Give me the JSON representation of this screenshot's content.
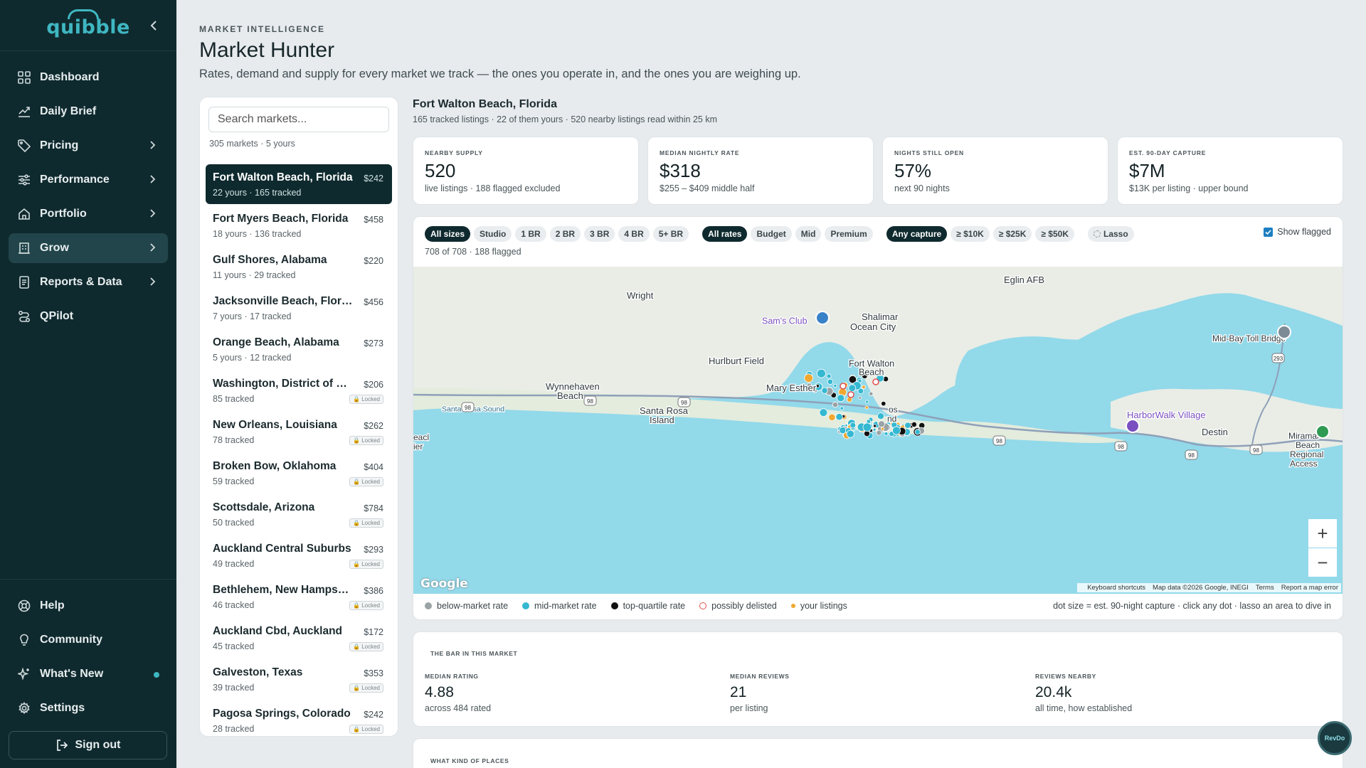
{
  "app": {
    "logo_text": "quibble",
    "brand_color": "#3fb7c2",
    "sidebar_bg": "#0f2a2e"
  },
  "sidebar": {
    "items": [
      {
        "label": "Dashboard",
        "icon": "grid-icon"
      },
      {
        "label": "Daily Brief",
        "icon": "chart-up-icon"
      },
      {
        "label": "Pricing",
        "icon": "tag-icon",
        "has_submenu": true
      },
      {
        "label": "Performance",
        "icon": "sliders-icon",
        "has_submenu": true
      },
      {
        "label": "Portfolio",
        "icon": "home-icon",
        "has_submenu": true
      },
      {
        "label": "Grow",
        "icon": "building-icon",
        "has_submenu": true,
        "active": true
      },
      {
        "label": "Reports & Data",
        "icon": "document-icon",
        "has_submenu": true
      },
      {
        "label": "QPilot",
        "icon": "route-icon"
      }
    ],
    "bottom_items": [
      {
        "label": "Help",
        "icon": "help-icon"
      },
      {
        "label": "Community",
        "icon": "lightbulb-icon"
      },
      {
        "label": "What's New",
        "icon": "sparkle-icon",
        "badge_dot": true
      },
      {
        "label": "Settings",
        "icon": "gear-icon"
      }
    ],
    "sign_out": "Sign out"
  },
  "header": {
    "eyebrow": "MARKET INTELLIGENCE",
    "title": "Market Hunter",
    "subtitle": "Rates, demand and supply for every market we track — the ones you operate in, and the ones you are weighing up."
  },
  "market_list": {
    "search_placeholder": "Search markets...",
    "count": "305 markets · 5 yours",
    "markets": [
      {
        "name": "Fort Walton Beach, Florida",
        "meta": "22 yours · 165 tracked",
        "price": "$242",
        "selected": true,
        "locked": false
      },
      {
        "name": "Fort Myers Beach, Florida",
        "meta": "18 yours · 136 tracked",
        "price": "$458",
        "locked": false
      },
      {
        "name": "Gulf Shores, Alabama",
        "meta": "11 yours · 29 tracked",
        "price": "$220",
        "locked": false
      },
      {
        "name": "Jacksonville Beach, Florida",
        "meta": "7 yours · 17 tracked",
        "price": "$456",
        "locked": false
      },
      {
        "name": "Orange Beach, Alabama",
        "meta": "5 yours · 12 tracked",
        "price": "$273",
        "locked": false
      },
      {
        "name": "Washington, District of Columbia",
        "meta": "85 tracked",
        "price": "$206",
        "locked": true
      },
      {
        "name": "New Orleans, Louisiana",
        "meta": "78 tracked",
        "price": "$262",
        "locked": true
      },
      {
        "name": "Broken Bow, Oklahoma",
        "meta": "59 tracked",
        "price": "$404",
        "locked": true
      },
      {
        "name": "Scottsdale, Arizona",
        "meta": "50 tracked",
        "price": "$784",
        "locked": true
      },
      {
        "name": "Auckland Central Suburbs",
        "meta": "49 tracked",
        "price": "$293",
        "locked": true
      },
      {
        "name": "Bethlehem, New Hampshire",
        "meta": "46 tracked",
        "price": "$386",
        "locked": true
      },
      {
        "name": "Auckland Cbd, Auckland",
        "meta": "45 tracked",
        "price": "$172",
        "locked": true
      },
      {
        "name": "Galveston, Texas",
        "meta": "39 tracked",
        "price": "$353",
        "locked": true
      },
      {
        "name": "Pagosa Springs, Colorado",
        "meta": "28 tracked",
        "price": "$242",
        "locked": true
      }
    ],
    "locked_label": "Locked"
  },
  "location": {
    "title": "Fort Walton Beach, Florida",
    "subtitle": "165 tracked listings · 22 of them yours · 520 nearby listings read within 25 km"
  },
  "stats": [
    {
      "label": "NEARBY SUPPLY",
      "value": "520",
      "note": "live listings · 188 flagged excluded"
    },
    {
      "label": "MEDIAN NIGHTLY RATE",
      "value": "$318",
      "note": "$255 – $409 middle half"
    },
    {
      "label": "NIGHTS STILL OPEN",
      "value": "57%",
      "note": "next 90 nights"
    },
    {
      "label": "EST. 90-DAY CAPTURE",
      "value": "$7M",
      "note": "$13K per listing · upper bound"
    }
  ],
  "filters": {
    "sizes": [
      {
        "label": "All sizes",
        "on": true
      },
      {
        "label": "Studio"
      },
      {
        "label": "1 BR"
      },
      {
        "label": "2 BR"
      },
      {
        "label": "3 BR"
      },
      {
        "label": "4 BR"
      },
      {
        "label": "5+ BR"
      }
    ],
    "rates": [
      {
        "label": "All rates",
        "on": true
      },
      {
        "label": "Budget"
      },
      {
        "label": "Mid"
      },
      {
        "label": "Premium"
      }
    ],
    "capture": [
      {
        "label": "Any capture",
        "on": true
      },
      {
        "label": "≥ $10K"
      },
      {
        "label": "≥ $25K"
      },
      {
        "label": "≥ $50K"
      }
    ],
    "lasso": "Lasso",
    "show_flagged": "Show flagged",
    "show_flagged_checked": true,
    "count": "708 of 708 · 188 flagged"
  },
  "map": {
    "labels": [
      {
        "text": "Eglin AFB"
      },
      {
        "text": "Wright"
      },
      {
        "text": "Shalimar"
      },
      {
        "text": "Sam's Club"
      },
      {
        "text": "Ocean City"
      },
      {
        "text": "Mid-Bay Toll Bridge"
      },
      {
        "text": "Hurlburt Field"
      },
      {
        "text": "Fort Walton"
      },
      {
        "text": "Beach"
      },
      {
        "text": "Wynnehaven"
      },
      {
        "text": "Beach"
      },
      {
        "text": "Mary Esther"
      },
      {
        "text": "Santa Rosa Sound"
      },
      {
        "text": "Santa Rosa"
      },
      {
        "text": "Island"
      },
      {
        "text": "HarborWalk Village"
      },
      {
        "text": "Destin"
      },
      {
        "text": "Miramar"
      },
      {
        "text": "Beach"
      },
      {
        "text": "Regional"
      },
      {
        "text": "Access"
      },
      {
        "text": "eacl"
      },
      {
        "text": "ier"
      },
      {
        "text": "os"
      },
      {
        "text": "nd"
      }
    ],
    "route_shields": [
      "98",
      "98",
      "98",
      "98",
      "98",
      "98",
      "98",
      "293"
    ],
    "google": "Google",
    "attribution": [
      "Keyboard shortcuts",
      "Map data ©2026 Google, INEGI",
      "Terms",
      "Report a map error"
    ],
    "water_color": "#92d9ea",
    "land_color": "#e9ede6"
  },
  "legend": [
    {
      "label": "below-market rate",
      "color": "#9aa3a6"
    },
    {
      "label": "mid-market rate",
      "color": "#35b8d1"
    },
    {
      "label": "top-quartile rate",
      "color": "#111111"
    },
    {
      "label": "possibly delisted",
      "color": "#e05050"
    },
    {
      "label": "your listings",
      "color": "#f0a830"
    }
  ],
  "legend_hint": "dot size = est. 90-night capture · click any dot · lasso an area to dive in",
  "bar_card": {
    "heading": "THE BAR IN THIS MARKET",
    "cols": [
      {
        "label": "MEDIAN RATING",
        "value": "4.88",
        "note": "across 484 rated"
      },
      {
        "label": "MEDIAN REVIEWS",
        "value": "21",
        "note": "per listing"
      },
      {
        "label": "REVIEWS NEARBY",
        "value": "20.4k",
        "note": "all time, how established"
      }
    ]
  },
  "places_card": {
    "heading": "WHAT KIND OF PLACES"
  },
  "widget": {
    "label": "RevDo"
  }
}
